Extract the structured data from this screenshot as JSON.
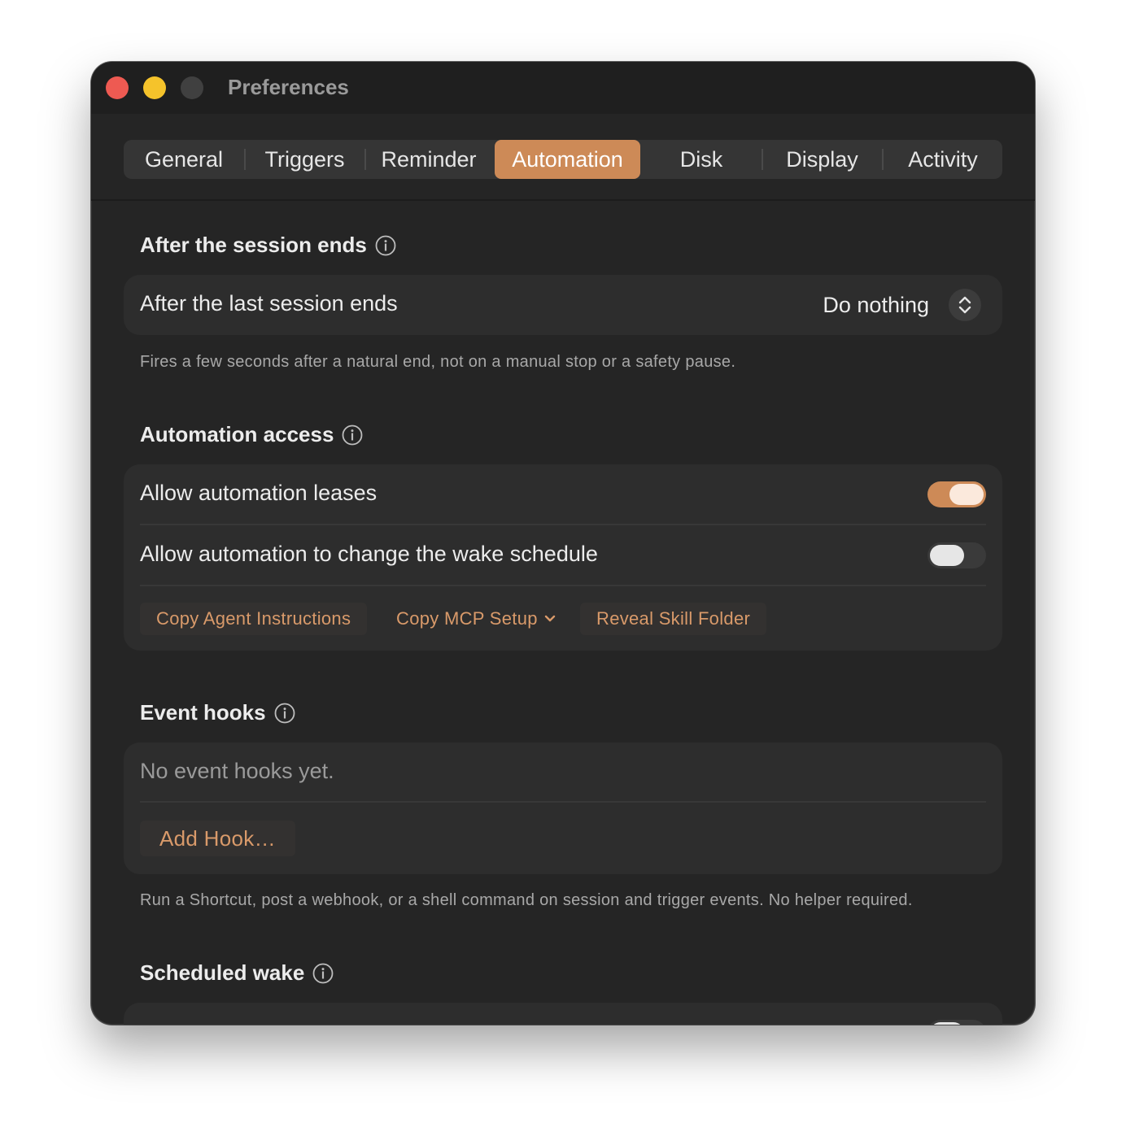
{
  "window": {
    "title": "Preferences"
  },
  "tabs": [
    {
      "label": "General"
    },
    {
      "label": "Triggers"
    },
    {
      "label": "Reminder"
    },
    {
      "label": "Automation",
      "active": true
    },
    {
      "label": "Disk"
    },
    {
      "label": "Display"
    },
    {
      "label": "Activity"
    }
  ],
  "sections": {
    "after_session": {
      "title": "After the session ends",
      "row_label": "After the last session ends",
      "popup_value": "Do nothing",
      "note": "Fires a few seconds after a natural end, not on a manual stop or a safety pause."
    },
    "automation_access": {
      "title": "Automation access",
      "leases_label": "Allow automation leases",
      "leases_on": true,
      "wake_label": "Allow automation to change the wake schedule",
      "wake_on": false,
      "copy_instructions": "Copy Agent Instructions",
      "copy_mcp": "Copy MCP Setup",
      "reveal_skill": "Reveal Skill Folder"
    },
    "event_hooks": {
      "title": "Event hooks",
      "empty": "No event hooks yet.",
      "add_hook": "Add Hook…",
      "note": "Run a Shortcut, post a webhook, or a shell command on session and trigger events. No helper required."
    },
    "scheduled_wake": {
      "title": "Scheduled wake"
    }
  },
  "colors": {
    "accent": "#cd8a57",
    "window_bg": "#252525",
    "card_bg": "#2d2d2d"
  }
}
